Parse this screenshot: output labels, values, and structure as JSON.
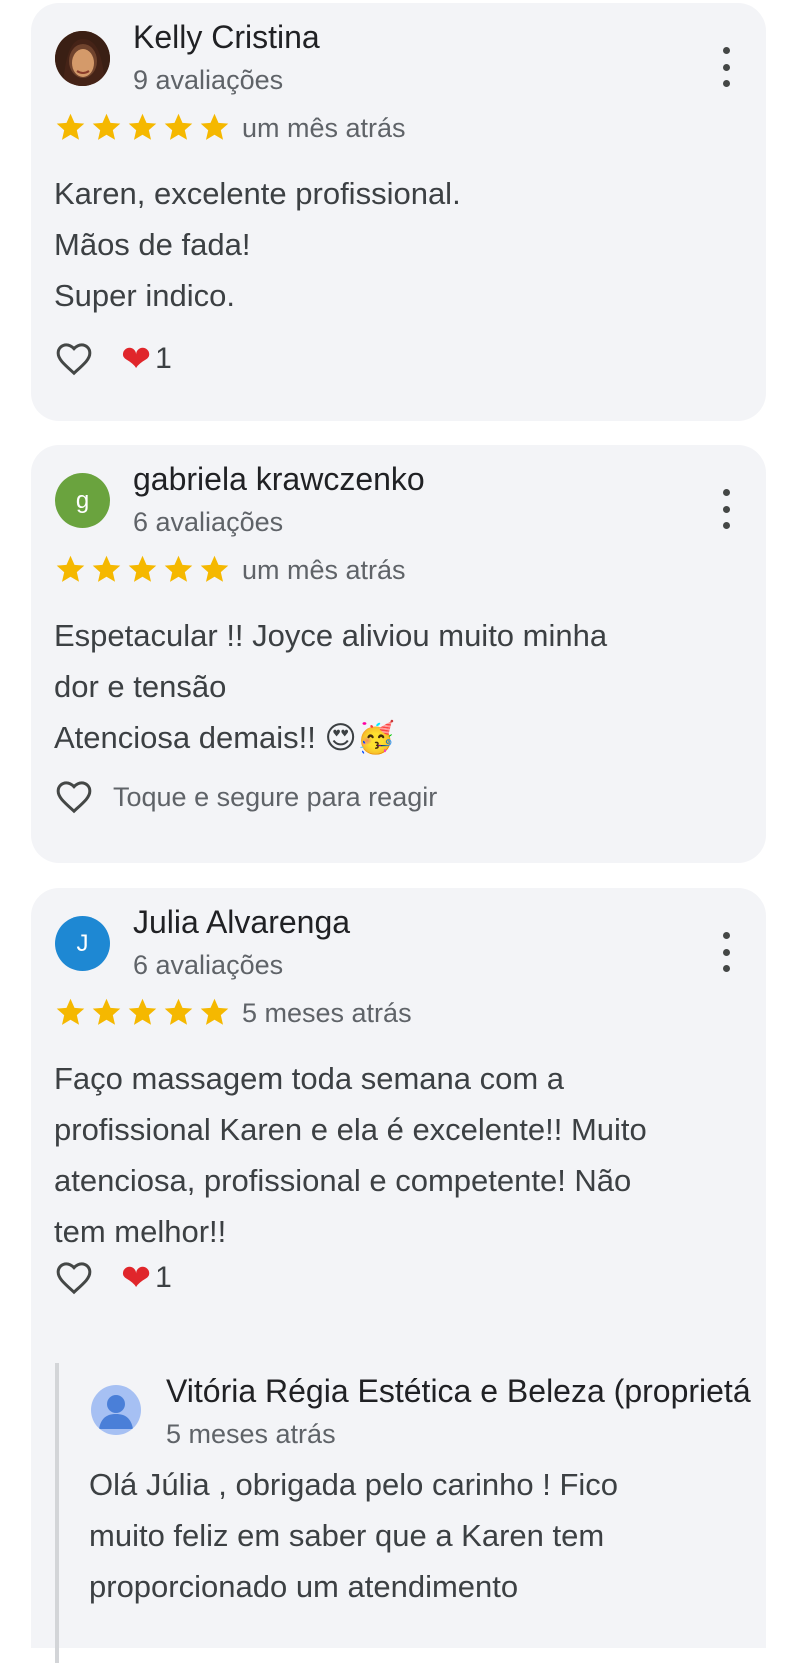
{
  "reviews": [
    {
      "author": "Kelly Cristina",
      "review_count": "9 avaliações",
      "rating": 5,
      "date": "um mês atrás",
      "text_lines": [
        "Karen, excelente profissional.",
        "Mãos de fada!",
        "Super indico."
      ],
      "reaction_count": "1"
    },
    {
      "author": "gabriela krawczenko",
      "avatar_initial": "g",
      "avatar_color": "#6aa33e",
      "review_count": "6 avaliações",
      "rating": 5,
      "date": "um mês atrás",
      "text_lines": [
        "Espetacular !! Joyce aliviou muito minha",
        "dor e tensão",
        "Atenciosa demais!! 😍🥳"
      ],
      "reaction_hint": "Toque e segure para reagir"
    },
    {
      "author": "Julia Alvarenga",
      "avatar_initial": "J",
      "avatar_color": "#1e88d3",
      "review_count": "6 avaliações",
      "rating": 5,
      "date": "5 meses atrás",
      "text_lines": [
        "Faço massagem toda semana com a",
        "profissional Karen e ela é excelente!! Muito",
        "atenciosa, profissional e competente! Não",
        "tem melhor!!"
      ],
      "reaction_count": "1",
      "owner_reply": {
        "author": "Vitória Régia Estética e Beleza (proprietá",
        "date": "5 meses atrás",
        "text_lines": [
          "Olá Júlia , obrigada pelo carinho ! Fico",
          "muito feliz em saber que a Karen tem",
          "proporcionado um atendimento"
        ]
      }
    }
  ],
  "colors": {
    "star": "#f5b800",
    "heart": "#e0262b",
    "card_bg": "#f3f4f7"
  },
  "icons": {
    "star": "star-icon",
    "like": "heart-outline-icon",
    "more": "more-vert-icon",
    "react": "red-heart-icon"
  }
}
